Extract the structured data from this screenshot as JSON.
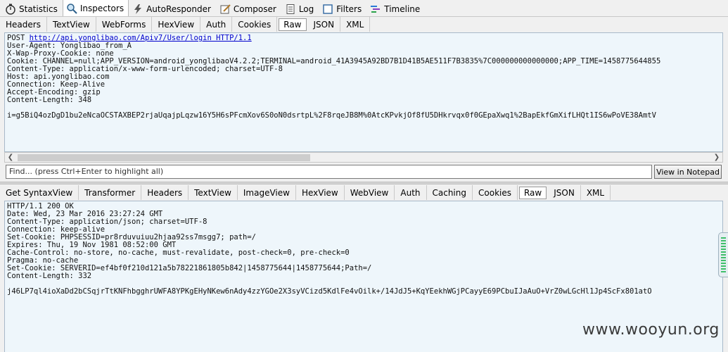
{
  "top_tabs": [
    {
      "label": "Statistics",
      "icon": "stopwatch-icon"
    },
    {
      "label": "Inspectors",
      "icon": "magnifier-icon",
      "active": true
    },
    {
      "label": "AutoResponder",
      "icon": "lightning-icon"
    },
    {
      "label": "Composer",
      "icon": "composer-icon"
    },
    {
      "label": "Log",
      "icon": "log-icon"
    },
    {
      "label": "Filters",
      "icon": "checkbox-icon"
    },
    {
      "label": "Timeline",
      "icon": "timeline-icon"
    }
  ],
  "request": {
    "tabs": [
      "Headers",
      "TextView",
      "WebForms",
      "HexView",
      "Auth",
      "Cookies",
      "Raw",
      "JSON",
      "XML"
    ],
    "active_tab": "Raw",
    "method": "POST ",
    "url": "http://api.yonglibao.com/Apiv7/User/login HTTP/1.1",
    "headers": [
      "User-Agent: Yonglibao_from_A",
      "X-Wap-Proxy-Cookie: none",
      "Cookie: CHANNEL=null;APP_VERSION=android_yonglibaoV4.2.2;TERMINAL=android_41A3945A92BD7B1D41B5AE511F7B3835%7C000000000000000;APP_TIME=1458775644855",
      "Content-Type: application/x-www-form-urlencoded; charset=UTF-8",
      "Host: api.yonglibao.com",
      "Connection: Keep-Alive",
      "Accept-Encoding: gzip",
      "Content-Length: 348"
    ],
    "body": "i=g5BiQ4ozDgD1bu2eNcaOCSTAXBEP2rjaUqajpLqzw16Y5H6sPFcmXov6S0oN0dsrtpL%2F8rqeJB8M%0AtcKPvkjOf8fU5DHkrvqx0f0GEpaXwq1%2BapEkfGmXifLHQt1IS6wPoVE38AmtV",
    "find_placeholder": "Find... (press Ctrl+Enter to highlight all)",
    "notepad_label": "View in Notepad"
  },
  "response": {
    "tabs": [
      "Get SyntaxView",
      "Transformer",
      "Headers",
      "TextView",
      "ImageView",
      "HexView",
      "WebView",
      "Auth",
      "Caching",
      "Cookies",
      "Raw",
      "JSON",
      "XML"
    ],
    "active_tab": "Raw",
    "lines": [
      "HTTP/1.1 200 OK",
      "Date: Wed, 23 Mar 2016 23:27:24 GMT",
      "Content-Type: application/json; charset=UTF-8",
      "Connection: keep-alive",
      "Set-Cookie: PHPSESSID=pr8rduvuiuu2hjaa92ss7msgg7; path=/",
      "Expires: Thu, 19 Nov 1981 08:52:00 GMT",
      "Cache-Control: no-store, no-cache, must-revalidate, post-check=0, pre-check=0",
      "Pragma: no-cache",
      "Set-Cookie: SERVERID=ef4bf0f210d121a5b78221861805b842|1458775644|1458775644;Path=/",
      "Content-Length: 332"
    ],
    "body": "j46LP7ql4ioXaDd2bCSqjrTtKNFhbgghrUWFA8YPKgEHyNKew6nAdy4zzYGOe2X3syVCizd5KdlFe4vOilk+/14JdJ5+KqYEekhWGjPCayyE69PCbuIJaAuO+VrZ0wLGcHl1Jp4ScFx801atO"
  },
  "watermark": "www.wooyun.org"
}
